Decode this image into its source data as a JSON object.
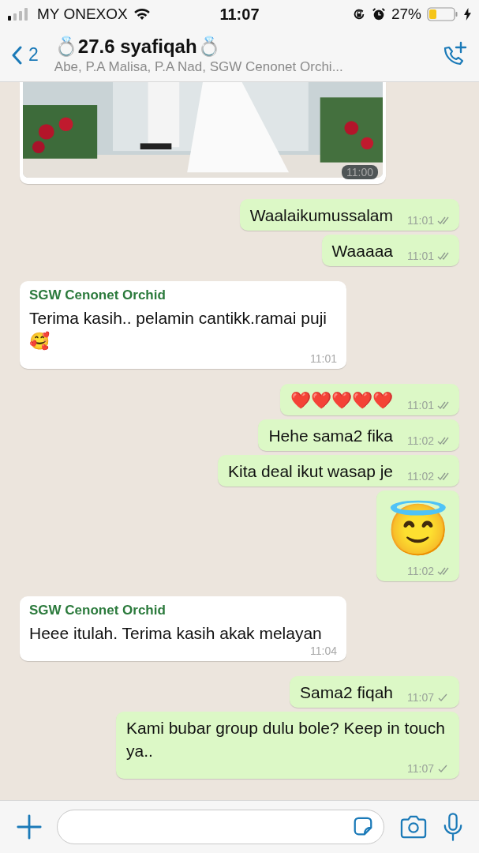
{
  "status_bar": {
    "carrier": "MY ONEXOX",
    "time": "11:07",
    "battery": "27%"
  },
  "header": {
    "back_count": "2",
    "title": "💍27.6 syafiqah💍",
    "subtitle": "Abe, P.A Malisa, P.A Nad, SGW Cenonet Orchi..."
  },
  "messages": [
    {
      "outgoing": false,
      "time": "11:00"
    },
    {
      "kind": "text",
      "outgoing": true,
      "text": "Waalaikumussalam",
      "time": "11:01",
      "read": true
    },
    {
      "kind": "text",
      "outgoing": true,
      "text": "Waaaaa",
      "time": "11:01",
      "read": true
    },
    {
      "kind": "text",
      "outgoing": false,
      "sender": "SGW Cenonet Orchid",
      "text": "Terima kasih.. pelamin cantikk.ramai puji🥰",
      "time": "11:01"
    },
    {
      "kind": "text",
      "outgoing": true,
      "text": "❤️❤️❤️❤️❤️",
      "time": "11:01",
      "read": true
    },
    {
      "kind": "text",
      "outgoing": true,
      "text": "Hehe sama2 fika",
      "time": "11:02",
      "read": true
    },
    {
      "kind": "text",
      "outgoing": true,
      "text": "Kita deal ikut wasap je",
      "time": "11:02",
      "read": true
    },
    {
      "kind": "emoji",
      "outgoing": true,
      "text": "😇",
      "time": "11:02",
      "read": true
    },
    {
      "kind": "text",
      "outgoing": false,
      "sender": "SGW Cenonet Orchid",
      "text": "Heee itulah. Terima kasih akak melayan",
      "time": "11:04"
    },
    {
      "kind": "text",
      "outgoing": true,
      "text": "Sama2 fiqah",
      "time": "11:07",
      "read": false
    },
    {
      "kind": "text",
      "outgoing": true,
      "text": "Kami bubar group dulu bole? Keep in touch ya..",
      "time": "11:07",
      "read": false
    }
  ]
}
